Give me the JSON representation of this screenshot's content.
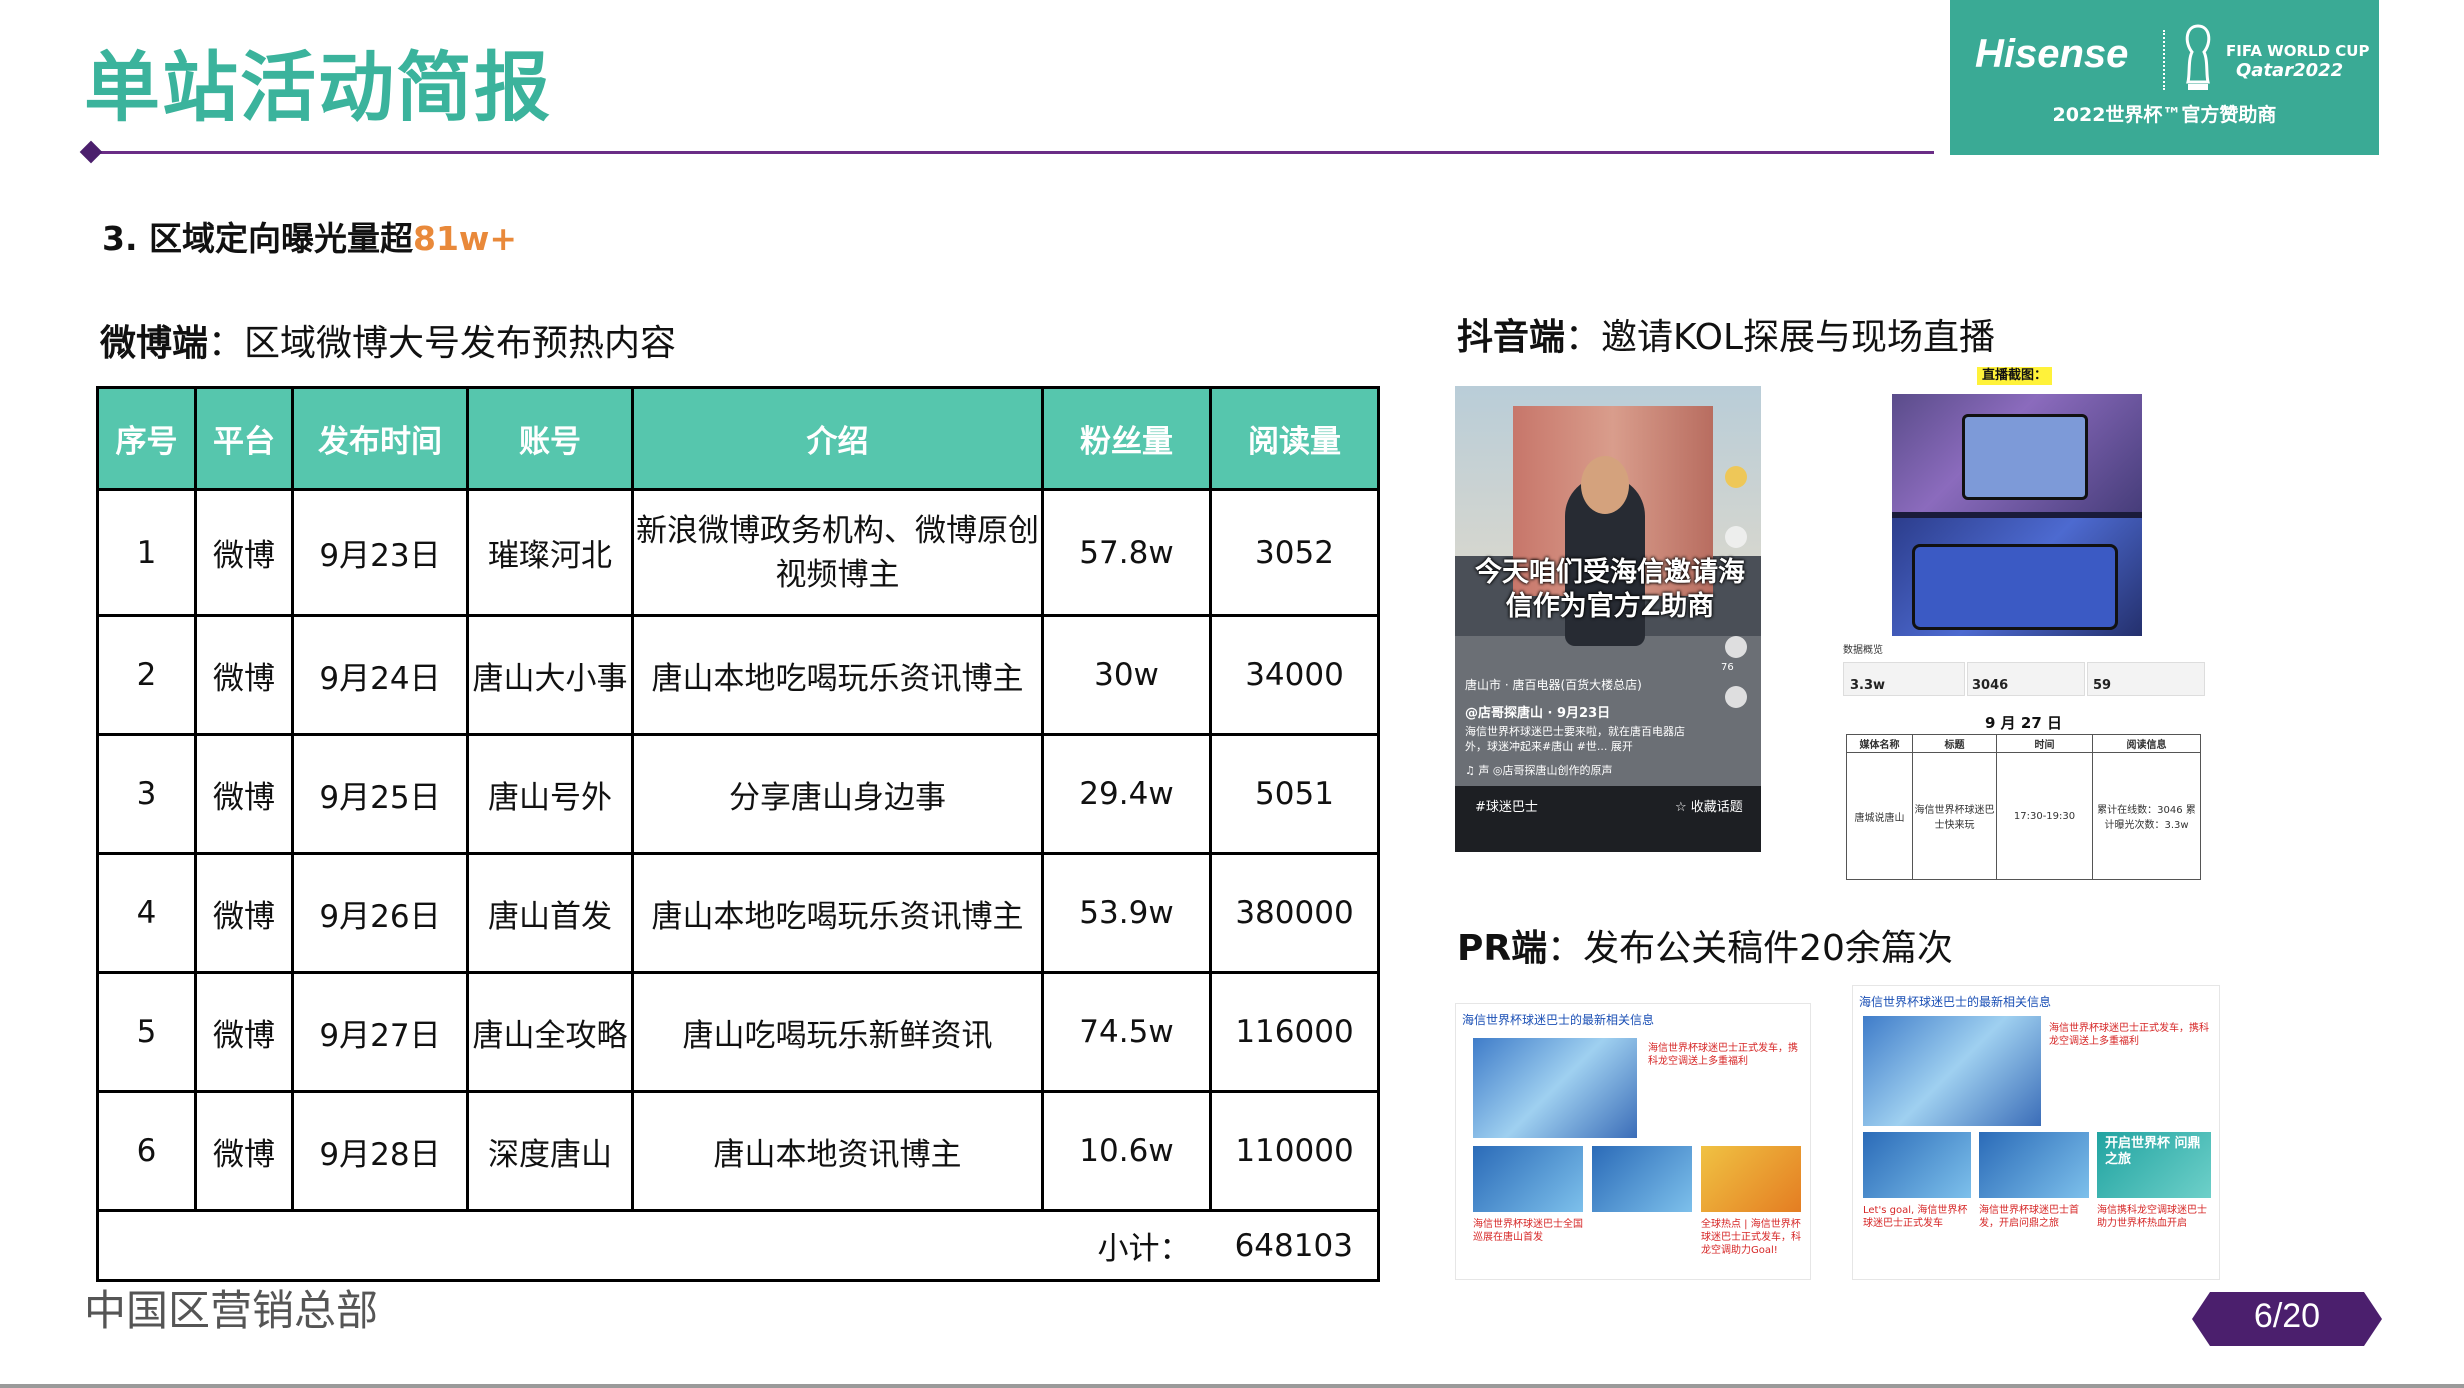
{
  "header": {
    "title": "单站活动简报",
    "brand_name": "Hisense",
    "brand_event_line1": "FIFA WORLD CUP",
    "brand_event_line2": "Qatar2022",
    "brand_sponsor": "2022世界杯™官方赞助商"
  },
  "subhead": {
    "prefix": "3. 区域定向曝光量超",
    "highlight": "81w+"
  },
  "weibo": {
    "label_bold": "微博端",
    "label_rest": "：区域微博大号发布预热内容",
    "columns": [
      "序号",
      "平台",
      "发布时间",
      "账号",
      "介绍",
      "粉丝量",
      "阅读量"
    ],
    "rows": [
      {
        "no": "1",
        "platform": "微博",
        "date": "9月23日",
        "account": "璀璨河北",
        "intro": "新浪微博政务机构、微博原创视频博主",
        "fans": "57.8w",
        "reads": "3052"
      },
      {
        "no": "2",
        "platform": "微博",
        "date": "9月24日",
        "account": "唐山大小事",
        "intro": "唐山本地吃喝玩乐资讯博主",
        "fans": "30w",
        "reads": "34000"
      },
      {
        "no": "3",
        "platform": "微博",
        "date": "9月25日",
        "account": "唐山号外",
        "intro": "分享唐山身边事",
        "fans": "29.4w",
        "reads": "5051"
      },
      {
        "no": "4",
        "platform": "微博",
        "date": "9月26日",
        "account": "唐山首发",
        "intro": "唐山本地吃喝玩乐资讯博主",
        "fans": "53.9w",
        "reads": "380000"
      },
      {
        "no": "5",
        "platform": "微博",
        "date": "9月27日",
        "account": "唐山全攻略",
        "intro": "唐山吃喝玩乐新鲜资讯",
        "fans": "74.5w",
        "reads": "116000"
      },
      {
        "no": "6",
        "platform": "微博",
        "date": "9月28日",
        "account": "深度唐山",
        "intro": "唐山本地资讯博主",
        "fans": "10.6w",
        "reads": "110000"
      }
    ],
    "subtotal_label": "小计：",
    "subtotal_value": "648103"
  },
  "douyin": {
    "label_bold": "抖音端",
    "label_rest": "：邀请KOL探展与现场直播",
    "phone_caption": "今天咱们受海信邀请海信作为官方Z助商",
    "phone_location": "唐山市 · 唐百电器(百货大楼总店)",
    "phone_author": "@店哥探唐山 · 9月23日",
    "phone_desc": "海信世界杯球迷巴士要来啦，就在唐百电器店外，球迷冲起来#唐山 #世... 展开",
    "phone_music": "♫ 声 ◎店哥探唐山创作的原声",
    "phone_tag": "#球迷巴士",
    "phone_collect": "☆ 收藏话题",
    "phone_likes": "76",
    "live_label": "直播截图：",
    "stats_label": "数据概览",
    "stats": [
      "3.3w",
      "3046",
      "59"
    ],
    "mini_date": "9 月 27 日",
    "mini_headers": [
      "媒体名称",
      "标题",
      "时间",
      "阅读信息"
    ],
    "mini_row": [
      "唐城说唐山",
      "海信世界杯球迷巴士快来玩",
      "17:30-19:30",
      "累计在线数：3046 累计曝光次数：3.3w"
    ]
  },
  "pr": {
    "label_bold": "PR端",
    "label_rest": "：发布公关稿件20余篇次",
    "card1_header": "海信世界杯球迷巴士的最新相关信息",
    "card1_main_title": "海信世界杯球迷巴士正式发车，携科龙空调送上多重福利",
    "card1_thumb1": "海信世界杯球迷巴士全国巡展在唐山首发",
    "card1_thumb2": "全球热点 | 海信世界杯球迷巴士正式发车，科龙空调助力Goal!",
    "card2_header": "海信世界杯球迷巴士的最新相关信息",
    "card2_main_title": "海信世界杯球迷巴士正式发车，携科龙空调送上多重福利",
    "card2_thumb1": "Let's goal, 海信世界杯球迷巴士正式发车",
    "card2_thumb2": "海信世界杯球迷巴士首发，开启问鼎之旅",
    "card2_thumb3": "海信携科龙空调球迷巴士助力世界杯热血开启",
    "card2_thumb3_title": "开启世界杯 问鼎之旅"
  },
  "footer": {
    "dept": "中国区营销总部",
    "page": "6/20"
  },
  "colors": {
    "title": "#3bb39c",
    "accent_line": "#6a2d86",
    "table_header": "#56c6ad",
    "highlight": "#e9893a",
    "badge": "#4b1f6d"
  }
}
